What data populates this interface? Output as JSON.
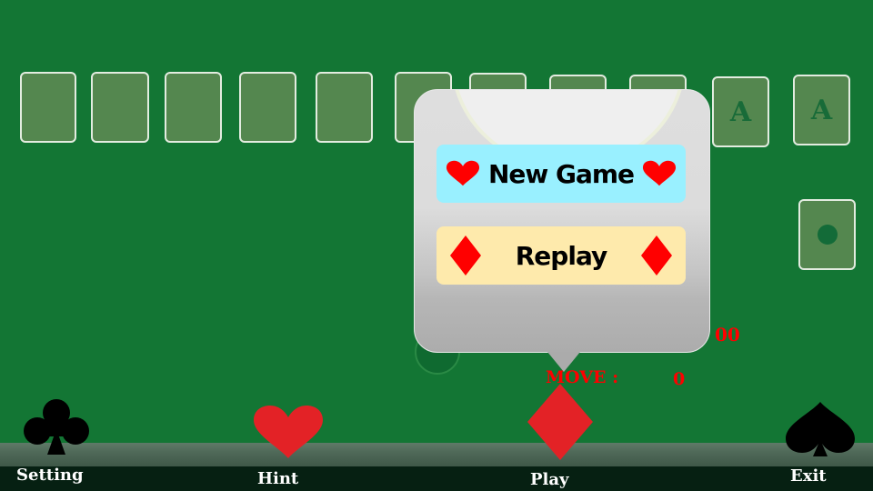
{
  "board": {
    "tableau_slots": 9,
    "foundations": [
      {
        "label": "A"
      },
      {
        "label": "A"
      }
    ],
    "stock": {
      "icon": "dot-icon"
    }
  },
  "stats": {
    "timer_fragment": "00",
    "move_label": "MOVE :",
    "move_value": "0"
  },
  "popup": {
    "new_game_label": "New Game",
    "replay_label": "Replay",
    "new_game_color": "#99f0ff",
    "replay_color": "#feeaac",
    "suit_color": "#ff0000"
  },
  "toolbar": {
    "items": [
      {
        "label": "Setting",
        "icon": "club-icon"
      },
      {
        "label": "Hint",
        "icon": "heart-icon"
      },
      {
        "label": "Play",
        "icon": "diamond-icon"
      },
      {
        "label": "Exit",
        "icon": "spade-icon"
      }
    ]
  },
  "colors": {
    "felt": "#137634",
    "slot": "#54874f",
    "accent_red": "#e32226"
  }
}
